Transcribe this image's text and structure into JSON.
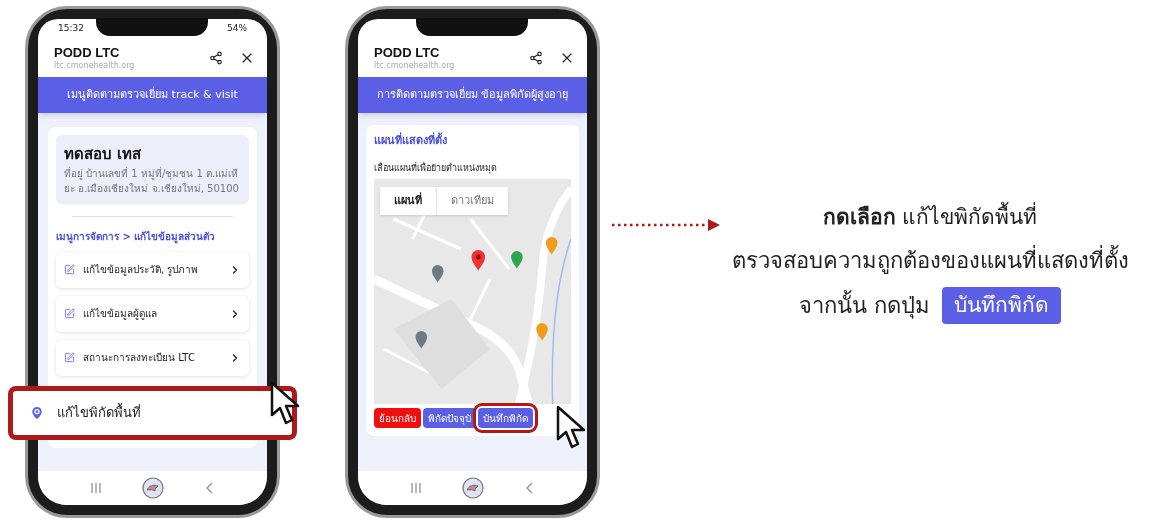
{
  "phones": [
    {
      "kind": "menu",
      "status_bar": {
        "time": "15:32",
        "battery": "54%"
      },
      "app_title": "PODD LTC",
      "url": "ltc.cmonehealth.org",
      "banner": "เมนูติดตามตรวจเยี่ยม track & visit",
      "profile": {
        "name": "ทดสอบ เทส",
        "address": "ที่อยู่ บ้านเลขที่ 1 หมู่ที่/ชุมชน 1 ต.แม่เหียะ อ.เมืองเชียงใหม่ จ.เชียงใหม่, 50100"
      },
      "section_title": "เมนูการจัดการ > แก้ไขข้อมูลส่วนตัว",
      "menu_items": [
        {
          "label": "แก้ไขข้อมูลประวัติ, รูปภาพ",
          "highlighted": false
        },
        {
          "label": "แก้ไขข้อมูลผู้ดูแล",
          "highlighted": false
        },
        {
          "label": "สถานะการลงทะเบียน LTC",
          "highlighted": false
        },
        {
          "label": "แก้ไขพิกัดพื้นที่",
          "highlighted": true
        }
      ]
    },
    {
      "kind": "map",
      "app_title": "PODD LTC",
      "url": "ltc.cmonehealth.org",
      "banner": "การติดตามตรวจเยี่ยม ข้อมูลพิกัดผู้สูงอายุ",
      "card_title": "แผนที่แสดงที่ตั้ง",
      "instruction": "เลื่อนแผนที่เพื่อย้ายตำแหน่งหมุด",
      "map_tabs": [
        {
          "label": "แผนที่",
          "selected": true
        },
        {
          "label": "ดาวเทียม",
          "selected": false
        }
      ],
      "buttons": [
        {
          "label": "ย้อนกลับ",
          "kind": "danger",
          "highlighted": false
        },
        {
          "label": "พิกัดปัจจุบั",
          "kind": "primary",
          "highlighted": false
        },
        {
          "label": "บันทึกพิกัด",
          "kind": "primary",
          "highlighted": true
        }
      ]
    }
  ],
  "instruction": {
    "line_1": "**กดเลือก** แก้ไขพิกัดพื้นที่",
    "line_2": "ตรวจสอบความถูกต้องของแผนที่แสดงที่ตั้ง",
    "line_3": "จากนั้น กดปุ่ม",
    "button_label": "บันทึกพิกัด"
  }
}
